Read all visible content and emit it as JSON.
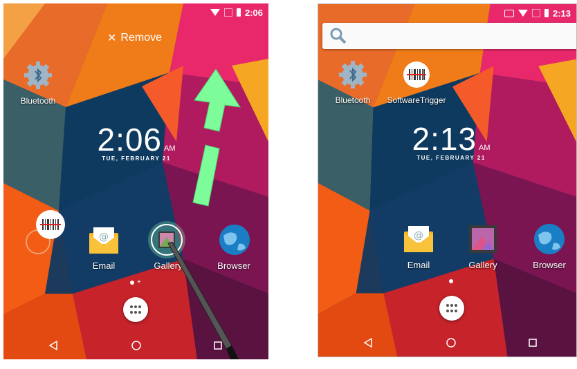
{
  "left_screen": {
    "status": {
      "time": "2:06"
    },
    "remove_label": "Remove",
    "apps": {
      "bluetooth": "Bluetooth",
      "email": "Email",
      "gallery": "Gallery",
      "browser": "Browser"
    },
    "clock": {
      "time": "2:06",
      "ampm": "AM",
      "date": "TUE, FEBRUARY 21"
    },
    "page_indicator": "+"
  },
  "right_screen": {
    "status": {
      "time": "2:13"
    },
    "apps": {
      "bluetooth": "Bluetooth",
      "software_trigger": "SoftwareTrigger",
      "email": "Email",
      "gallery": "Gallery",
      "browser": "Browser"
    },
    "clock": {
      "time": "2:13",
      "ampm": "AM",
      "date": "TUE, FEBRUARY 21"
    }
  },
  "colors": {
    "arrow": "#7dfc9a",
    "accent_orange": "#f25c14",
    "accent_pink": "#e8286b"
  }
}
